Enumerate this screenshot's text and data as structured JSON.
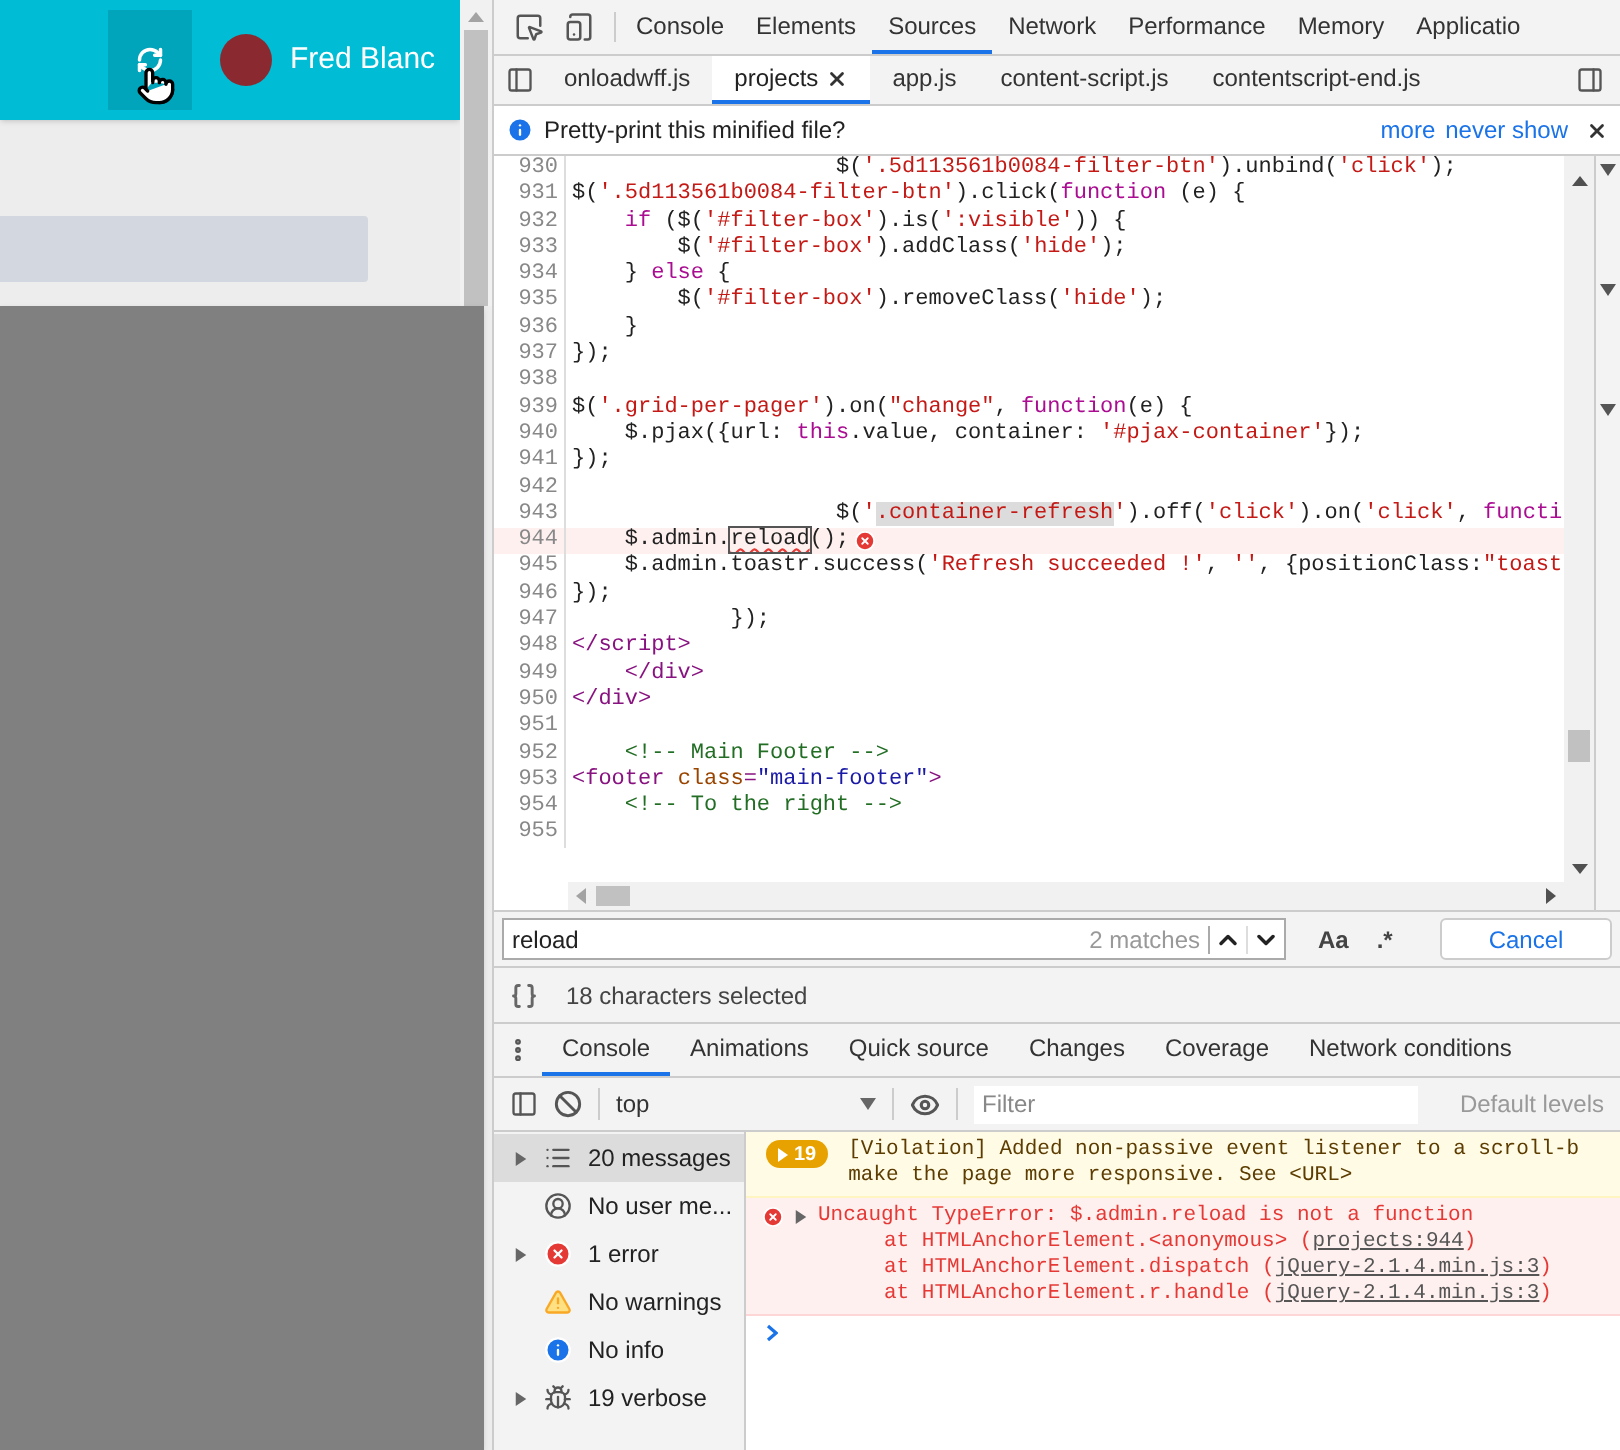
{
  "page": {
    "user_name": "Fred Blanc"
  },
  "panel_tabs": [
    {
      "label": "Console",
      "selected": false
    },
    {
      "label": "Elements",
      "selected": false
    },
    {
      "label": "Sources",
      "selected": true
    },
    {
      "label": "Network",
      "selected": false
    },
    {
      "label": "Performance",
      "selected": false
    },
    {
      "label": "Memory",
      "selected": false
    },
    {
      "label": "Applicatio",
      "selected": false
    }
  ],
  "file_tabs": [
    {
      "label": "onloadwff.js",
      "selected": false,
      "closable": false
    },
    {
      "label": "projects",
      "selected": true,
      "closable": true
    },
    {
      "label": "app.js",
      "selected": false,
      "closable": false
    },
    {
      "label": "content-script.js",
      "selected": false,
      "closable": false
    },
    {
      "label": "contentscript-end.js",
      "selected": false,
      "closable": false
    }
  ],
  "infobar": {
    "text": "Pretty-print this minified file?",
    "links": [
      "more",
      "never show"
    ]
  },
  "code_lines": [
    {
      "number": "930",
      "error": false,
      "tokens": [
        {
          "kind": "p",
          "text": "                    $("
        },
        {
          "kind": "s",
          "text": "'.5d113561b0084-filter-btn'"
        },
        {
          "kind": "p",
          "text": ").unbind("
        },
        {
          "kind": "s",
          "text": "'click'"
        },
        {
          "kind": "p",
          "text": ");"
        }
      ]
    },
    {
      "number": "931",
      "error": false,
      "tokens": [
        {
          "kind": "p",
          "text": "$("
        },
        {
          "kind": "s",
          "text": "'.5d113561b0084-filter-btn'"
        },
        {
          "kind": "p",
          "text": ").click("
        },
        {
          "kind": "k",
          "text": "function"
        },
        {
          "kind": "p",
          "text": " (e) {"
        }
      ]
    },
    {
      "number": "932",
      "error": false,
      "tokens": [
        {
          "kind": "k",
          "text": "    if"
        },
        {
          "kind": "p",
          "text": " ($("
        },
        {
          "kind": "s",
          "text": "'#filter-box'"
        },
        {
          "kind": "p",
          "text": ").is("
        },
        {
          "kind": "s",
          "text": "':visible'"
        },
        {
          "kind": "p",
          "text": ")) {"
        }
      ]
    },
    {
      "number": "933",
      "error": false,
      "tokens": [
        {
          "kind": "p",
          "text": "        $("
        },
        {
          "kind": "s",
          "text": "'#filter-box'"
        },
        {
          "kind": "p",
          "text": ").addClass("
        },
        {
          "kind": "s",
          "text": "'hide'"
        },
        {
          "kind": "p",
          "text": ");"
        }
      ]
    },
    {
      "number": "934",
      "error": false,
      "tokens": [
        {
          "kind": "p",
          "text": "    } "
        },
        {
          "kind": "k",
          "text": "else"
        },
        {
          "kind": "p",
          "text": " {"
        }
      ]
    },
    {
      "number": "935",
      "error": false,
      "tokens": [
        {
          "kind": "p",
          "text": "        $("
        },
        {
          "kind": "s",
          "text": "'#filter-box'"
        },
        {
          "kind": "p",
          "text": ").removeClass("
        },
        {
          "kind": "s",
          "text": "'hide'"
        },
        {
          "kind": "p",
          "text": ");"
        }
      ]
    },
    {
      "number": "936",
      "error": false,
      "tokens": [
        {
          "kind": "p",
          "text": "    }"
        }
      ]
    },
    {
      "number": "937",
      "error": false,
      "tokens": [
        {
          "kind": "p",
          "text": "});"
        }
      ]
    },
    {
      "number": "938",
      "error": false
    },
    {
      "number": "939",
      "error": false,
      "tokens": [
        {
          "kind": "p",
          "text": "$("
        },
        {
          "kind": "s",
          "text": "'.grid-per-pager'"
        },
        {
          "kind": "p",
          "text": ").on("
        },
        {
          "kind": "s",
          "text": "\"change\""
        },
        {
          "kind": "p",
          "text": ", "
        },
        {
          "kind": "k",
          "text": "function"
        },
        {
          "kind": "p",
          "text": "(e) {"
        }
      ]
    },
    {
      "number": "940",
      "error": false,
      "tokens": [
        {
          "kind": "p",
          "text": "    $.pjax({url: "
        },
        {
          "kind": "k",
          "text": "this"
        },
        {
          "kind": "p",
          "text": ".value, container: "
        },
        {
          "kind": "s",
          "text": "'#pjax-container'"
        },
        {
          "kind": "p",
          "text": "});"
        }
      ]
    },
    {
      "number": "941",
      "error": false,
      "tokens": [
        {
          "kind": "p",
          "text": "});"
        }
      ]
    },
    {
      "number": "942",
      "error": false
    },
    {
      "number": "943",
      "error": false,
      "tokens": [
        {
          "kind": "p",
          "text": "                    $("
        },
        {
          "kind": "s",
          "text": "'"
        },
        {
          "kind": "hl",
          "text": ".container-refresh"
        },
        {
          "kind": "s",
          "text": "'"
        },
        {
          "kind": "p",
          "text": ").off("
        },
        {
          "kind": "s",
          "text": "'click'"
        },
        {
          "kind": "p",
          "text": ").on("
        },
        {
          "kind": "s",
          "text": "'click'"
        },
        {
          "kind": "p",
          "text": ", "
        },
        {
          "kind": "k",
          "text": "functi"
        }
      ]
    },
    {
      "number": "944",
      "error": true,
      "tokens": [
        {
          "kind": "p",
          "text": "    $.admin."
        },
        {
          "kind": "m",
          "text": "reload"
        },
        {
          "kind": "p",
          "text": "();"
        }
      ]
    },
    {
      "number": "945",
      "error": false,
      "tokens": [
        {
          "kind": "p",
          "text": "    $.admin.toastr.success("
        },
        {
          "kind": "s",
          "text": "'Refresh succeeded !'"
        },
        {
          "kind": "p",
          "text": ", "
        },
        {
          "kind": "s",
          "text": "''"
        },
        {
          "kind": "p",
          "text": ", {positionClass:"
        },
        {
          "kind": "s",
          "text": "\"toast"
        }
      ]
    },
    {
      "number": "946",
      "error": false,
      "tokens": [
        {
          "kind": "p",
          "text": "});"
        }
      ]
    },
    {
      "number": "947",
      "error": false,
      "tokens": [
        {
          "kind": "p",
          "text": "            });"
        }
      ]
    },
    {
      "number": "948",
      "error": false,
      "tokens": [
        {
          "kind": "t",
          "text": "</script>"
        }
      ]
    },
    {
      "number": "949",
      "error": false,
      "tokens": [
        {
          "kind": "t",
          "text": "    </div>"
        }
      ]
    },
    {
      "number": "950",
      "error": false,
      "tokens": [
        {
          "kind": "t",
          "text": "</div>"
        }
      ]
    },
    {
      "number": "951",
      "error": false
    },
    {
      "number": "952",
      "error": false,
      "tokens": [
        {
          "kind": "c",
          "text": "    <!-- Main Footer -->"
        }
      ]
    },
    {
      "number": "953",
      "error": false,
      "tokens": [
        {
          "kind": "t",
          "text": "<footer "
        },
        {
          "kind": "a",
          "text": "class"
        },
        {
          "kind": "t",
          "text": "="
        },
        {
          "kind": "v",
          "text": "\"main-footer\""
        },
        {
          "kind": "t",
          "text": ">"
        }
      ]
    },
    {
      "number": "954",
      "error": false,
      "tokens": [
        {
          "kind": "c",
          "text": "    <!-- To the right -->"
        }
      ]
    },
    {
      "number": "955",
      "error": false
    }
  ],
  "search": {
    "value": "reload",
    "matches": "2 matches",
    "case_label": "Aa",
    "regex_label": ".*",
    "cancel": "Cancel"
  },
  "status": {
    "text": "18 characters selected"
  },
  "drawer_tabs": [
    {
      "label": "Console",
      "selected": true
    },
    {
      "label": "Animations",
      "selected": false
    },
    {
      "label": "Quick source",
      "selected": false
    },
    {
      "label": "Changes",
      "selected": false
    },
    {
      "label": "Coverage",
      "selected": false
    },
    {
      "label": "Network conditions",
      "selected": false
    }
  ],
  "console_toolbar": {
    "context": "top",
    "filter_placeholder": "Filter",
    "levels": "Default levels"
  },
  "sidebar": [
    {
      "kind": "list",
      "label": "20 messages",
      "expandable": true,
      "selected": true
    },
    {
      "kind": "user",
      "label": "No user me...",
      "expandable": false,
      "selected": false
    },
    {
      "kind": "error",
      "label": "1 error",
      "expandable": true,
      "selected": false
    },
    {
      "kind": "warning",
      "label": "No warnings",
      "expandable": false,
      "selected": false
    },
    {
      "kind": "info",
      "label": "No info",
      "expandable": false,
      "selected": false
    },
    {
      "kind": "verbose",
      "label": "19 verbose",
      "expandable": true,
      "selected": false
    }
  ],
  "messages": [
    {
      "kind": "warning",
      "count": "19",
      "lines": [
        "[Violation] Added non-passive event listener to a scroll-b",
        "make the page more responsive. See <URL>"
      ]
    },
    {
      "kind": "error",
      "title": "Uncaught TypeError: $.admin.reload is not a function",
      "stack": [
        {
          "prefix": "at HTMLAnchorElement.<anonymous> (",
          "link": "projects:944",
          "suffix": ")"
        },
        {
          "prefix": "at HTMLAnchorElement.dispatch (",
          "link": "jQuery-2.1.4.min.js:3",
          "suffix": ")"
        },
        {
          "prefix": "at HTMLAnchorElement.r.handle (",
          "link": "jQuery-2.1.4.min.js:3",
          "suffix": ")"
        }
      ]
    }
  ]
}
